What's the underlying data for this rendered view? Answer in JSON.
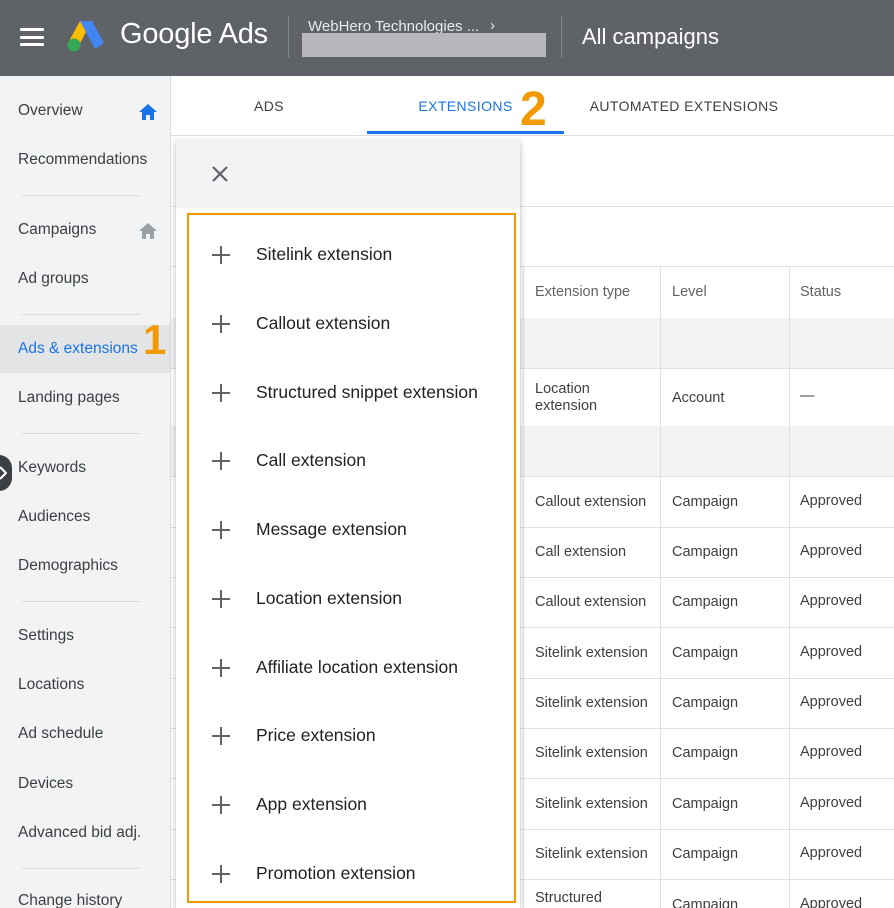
{
  "header": {
    "brand": "Google Ads",
    "account_name": "WebHero Technologies ...",
    "account_chevron": "›",
    "page_title": "All campaigns",
    "logo_icon": "google-ads-logo",
    "menu_icon": "hamburger-icon"
  },
  "sidebar": {
    "items": [
      {
        "label": "Overview"
      },
      {
        "label": "Recommendations"
      },
      {
        "label": "Campaigns"
      },
      {
        "label": "Ad groups"
      },
      {
        "label": "Ads & extensions"
      },
      {
        "label": "Landing pages"
      },
      {
        "label": "Keywords"
      },
      {
        "label": "Audiences"
      },
      {
        "label": "Demographics"
      },
      {
        "label": "Settings"
      },
      {
        "label": "Locations"
      },
      {
        "label": "Ad schedule"
      },
      {
        "label": "Devices"
      },
      {
        "label": "Advanced bid adj."
      },
      {
        "label": "Change history"
      }
    ],
    "active_item": "Ads & extensions"
  },
  "annotations": {
    "step_1": "1",
    "step_2": "2",
    "accent_color": "#f29900"
  },
  "tabs": [
    {
      "label": "ADS"
    },
    {
      "label": "EXTENSIONS"
    },
    {
      "label": "AUTOMATED EXTENSIONS"
    }
  ],
  "table": {
    "headers": {
      "type": "Extension type",
      "level": "Level",
      "status": "Status"
    },
    "rows": [
      {
        "type": "Location extension",
        "level": "Account",
        "status": "—"
      },
      {
        "type": "Callout extension",
        "level": "Campaign",
        "status": "Approved"
      },
      {
        "type": "Call extension",
        "level": "Campaign",
        "status": "Approved"
      },
      {
        "type": "Callout extension",
        "level": "Campaign",
        "status": "Approved"
      },
      {
        "type": "Sitelink extension",
        "level": "Campaign",
        "status": "Approved"
      },
      {
        "type": "Sitelink extension",
        "level": "Campaign",
        "status": "Approved"
      },
      {
        "type": "Sitelink extension",
        "level": "Campaign",
        "status": "Approved"
      },
      {
        "type": "Sitelink extension",
        "level": "Campaign",
        "status": "Approved"
      },
      {
        "type": "Sitelink extension",
        "level": "Campaign",
        "status": "Approved"
      },
      {
        "type": "Structured",
        "level": "Campaign",
        "status": "Approved"
      }
    ]
  },
  "panel": {
    "close_icon": "close-icon",
    "items": [
      {
        "label": "Sitelink extension"
      },
      {
        "label": "Callout extension"
      },
      {
        "label": "Structured snippet extension"
      },
      {
        "label": "Call extension"
      },
      {
        "label": "Message extension"
      },
      {
        "label": "Location extension"
      },
      {
        "label": "Affiliate location extension"
      },
      {
        "label": "Price extension"
      },
      {
        "label": "App extension"
      },
      {
        "label": "Promotion extension"
      }
    ]
  },
  "colors": {
    "header_bg": "#5f6368",
    "link_blue": "#1a73e8",
    "sidebar_bg": "#f1f3f4"
  }
}
